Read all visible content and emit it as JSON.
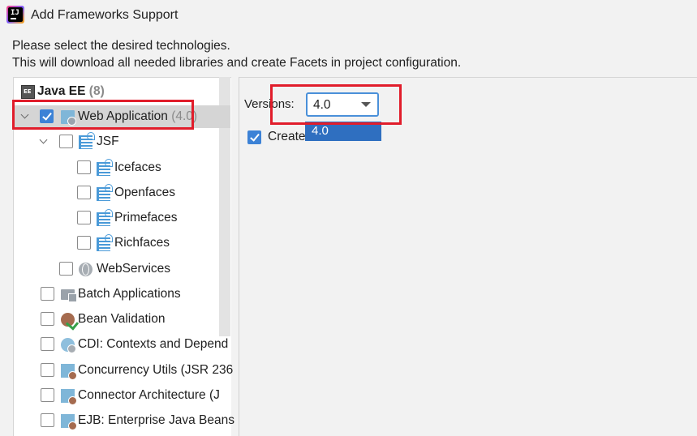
{
  "window": {
    "title": "Add Frameworks Support",
    "icon": "intellij-icon"
  },
  "description": {
    "line1": "Please select the desired technologies.",
    "line2": "This will download all needed libraries and create Facets in project configuration."
  },
  "tree": {
    "group": {
      "label": "Java EE",
      "count": "(8)",
      "icon": "javaee-icon"
    },
    "items": [
      {
        "label": "Web Application",
        "count": "(4.0)",
        "checked": true,
        "expanded": true,
        "icon": "web-app-icon"
      },
      {
        "label": "JSF",
        "checked": false,
        "expanded": true,
        "icon": "jsf-icon"
      },
      {
        "label": "Icefaces",
        "checked": false,
        "icon": "jsf-icon"
      },
      {
        "label": "Openfaces",
        "checked": false,
        "icon": "jsf-icon"
      },
      {
        "label": "Primefaces",
        "checked": false,
        "icon": "jsf-icon"
      },
      {
        "label": "Richfaces",
        "checked": false,
        "icon": "jsf-icon"
      },
      {
        "label": "WebServices",
        "checked": false,
        "icon": "globe-icon"
      },
      {
        "label": "Batch Applications",
        "checked": false,
        "icon": "folder-icon"
      },
      {
        "label": "Bean Validation",
        "checked": false,
        "icon": "bean-validation-icon"
      },
      {
        "label": "CDI: Contexts and Depend",
        "checked": false,
        "icon": "cdi-icon"
      },
      {
        "label": "Concurrency Utils (JSR 236",
        "checked": false,
        "icon": "concurrency-icon"
      },
      {
        "label": "Connector Architecture (J",
        "checked": false,
        "icon": "connector-icon"
      },
      {
        "label": "EJB: Enterprise Java Beans",
        "checked": false,
        "icon": "ejb-icon"
      }
    ]
  },
  "options": {
    "versions_label": "Versions:",
    "selected_version": "4.0",
    "dropdown_options": [
      "4.0"
    ],
    "create_label": "Create",
    "create_checked": true
  },
  "colors": {
    "highlight": "#e11d2b",
    "accent": "#3c82d6",
    "dropdown_selection": "#2f6fc0"
  }
}
